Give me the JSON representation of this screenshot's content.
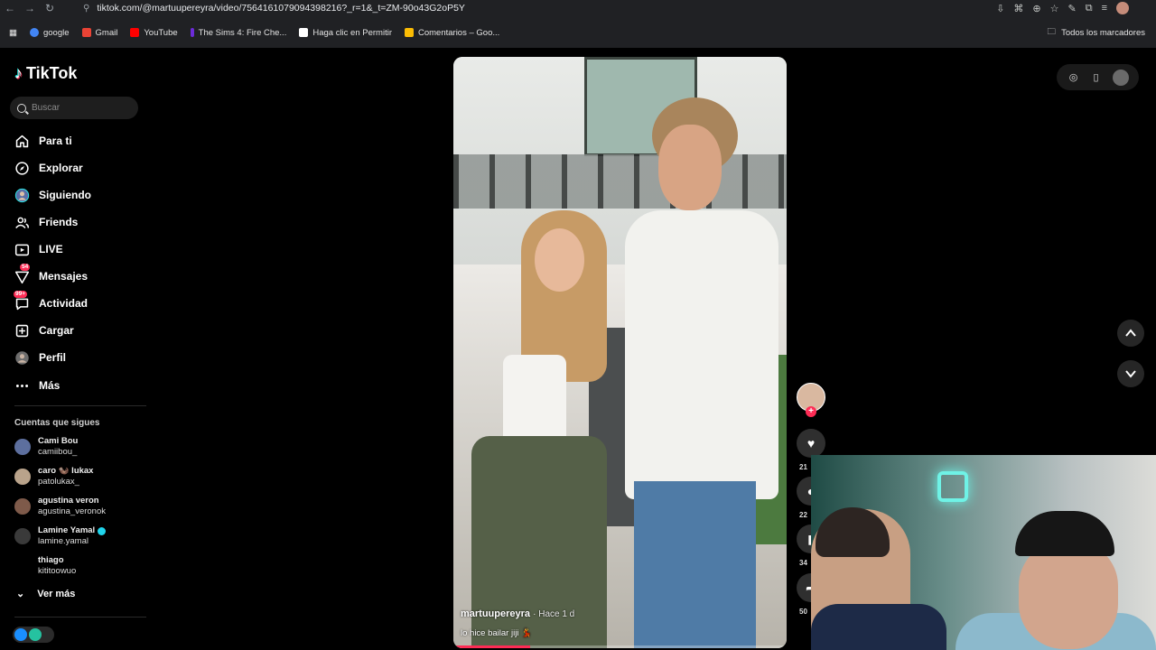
{
  "browser": {
    "url": "tiktok.com/@martuupereyra/video/7564161079094398216?_r=1&_t=ZM-90o43G2oP5Y",
    "bookmarks": [
      {
        "label": "google",
        "color": "#4285f4"
      },
      {
        "label": "Gmail",
        "color": "#ea4335"
      },
      {
        "label": "YouTube",
        "color": "#ff0000"
      },
      {
        "label": "The Sims 4: Fire Che...",
        "color": "#6c2bd9"
      },
      {
        "label": "Haga clic en Permitir",
        "color": "#ffffff"
      },
      {
        "label": "Comentarios – Goo...",
        "color": "#fbbc04"
      }
    ],
    "all_bookmarks": "Todos los marcadores"
  },
  "sidebar": {
    "brand": "TikTok",
    "search_placeholder": "Buscar",
    "nav": [
      {
        "label": "Para ti",
        "icon": "home-icon"
      },
      {
        "label": "Explorar",
        "icon": "compass-icon"
      },
      {
        "label": "Siguiendo",
        "icon": "following-avatar-icon"
      },
      {
        "label": "Friends",
        "icon": "friends-icon"
      },
      {
        "label": "LIVE",
        "icon": "live-icon"
      },
      {
        "label": "Mensajes",
        "icon": "messages-icon",
        "badge": "54"
      },
      {
        "label": "Actividad",
        "icon": "activity-icon",
        "badge": "99+"
      },
      {
        "label": "Cargar",
        "icon": "upload-icon"
      },
      {
        "label": "Perfil",
        "icon": "profile-avatar-icon"
      },
      {
        "label": "Más",
        "icon": "more-icon"
      }
    ],
    "following_title": "Cuentas que sigues",
    "following": [
      {
        "name": "Cami Bou",
        "user": "camiibou_",
        "verified": false
      },
      {
        "name": "caro 🦦 lukax",
        "user": "patolukax_",
        "verified": false
      },
      {
        "name": "agustina veron",
        "user": "agustina_veronok",
        "verified": false
      },
      {
        "name": "Lamine Yamal",
        "user": "lamine.yamal",
        "verified": true
      },
      {
        "name": "thiago",
        "user": "kititoowuo",
        "verified": false
      }
    ],
    "see_more": "Ver más"
  },
  "video": {
    "author": "martuupereyra",
    "time": "· Hace 1 d",
    "caption": "lo hice bailar jiji 💃",
    "progress_percent": 23
  },
  "actions": {
    "likes": "21",
    "comments": "22",
    "saves": "34",
    "shares": "50"
  },
  "colors": {
    "accent": "#fe2c55",
    "background": "#000000"
  }
}
